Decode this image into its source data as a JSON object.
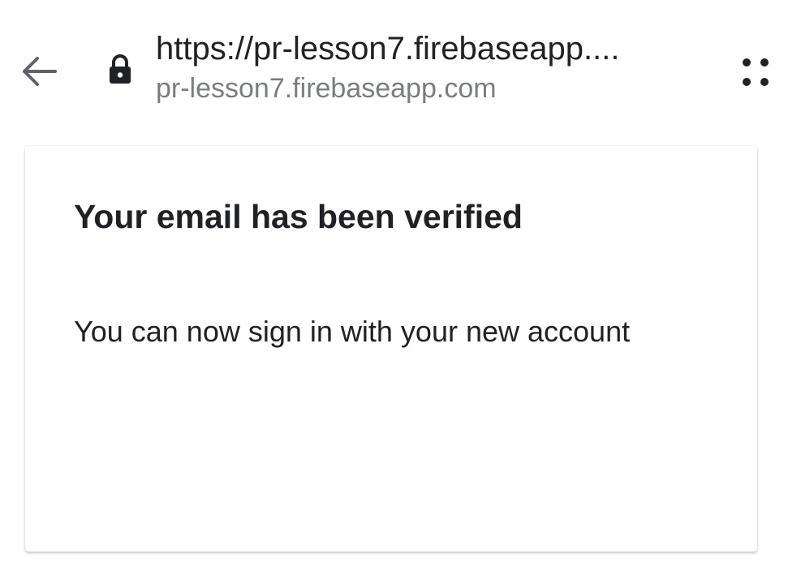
{
  "browser": {
    "url_title": "https://pr-lesson7.firebaseapp....",
    "url_domain": "pr-lesson7.firebaseapp.com",
    "icons": {
      "back": "arrow-left-icon",
      "lock": "lock-icon",
      "menu": "more-dots-icon"
    }
  },
  "card": {
    "title": "Your email has been verified",
    "message": "You can now sign in with your new account"
  },
  "colors": {
    "text_primary": "#202124",
    "text_secondary": "#7a7d80",
    "icon_gray": "#5f6368"
  }
}
